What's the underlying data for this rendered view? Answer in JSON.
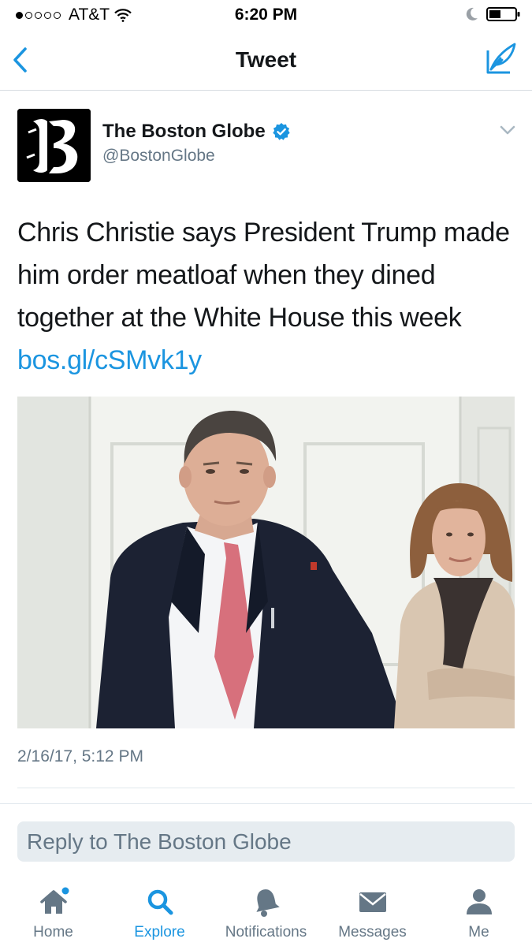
{
  "status_bar": {
    "carrier": "AT&T",
    "time": "6:20 PM"
  },
  "nav": {
    "title": "Tweet"
  },
  "tweet": {
    "author_name": "The Boston Globe",
    "author_handle": "@BostonGlobe",
    "text": "Chris Christie says President Trump made him order meatloaf when they dined together at the White House this week",
    "link": "bos.gl/cSMvk1y",
    "timestamp": "2/16/17, 5:12 PM"
  },
  "reply": {
    "placeholder": "Reply to The Boston Globe"
  },
  "tabs": [
    {
      "label": "Home",
      "icon": "home-icon"
    },
    {
      "label": "Explore",
      "icon": "search-icon"
    },
    {
      "label": "Notifications",
      "icon": "bell-icon"
    },
    {
      "label": "Messages",
      "icon": "envelope-icon"
    },
    {
      "label": "Me",
      "icon": "person-icon"
    }
  ],
  "colors": {
    "accent": "#1b95e0",
    "secondary_text": "#657786",
    "primary_text": "#14171a"
  }
}
